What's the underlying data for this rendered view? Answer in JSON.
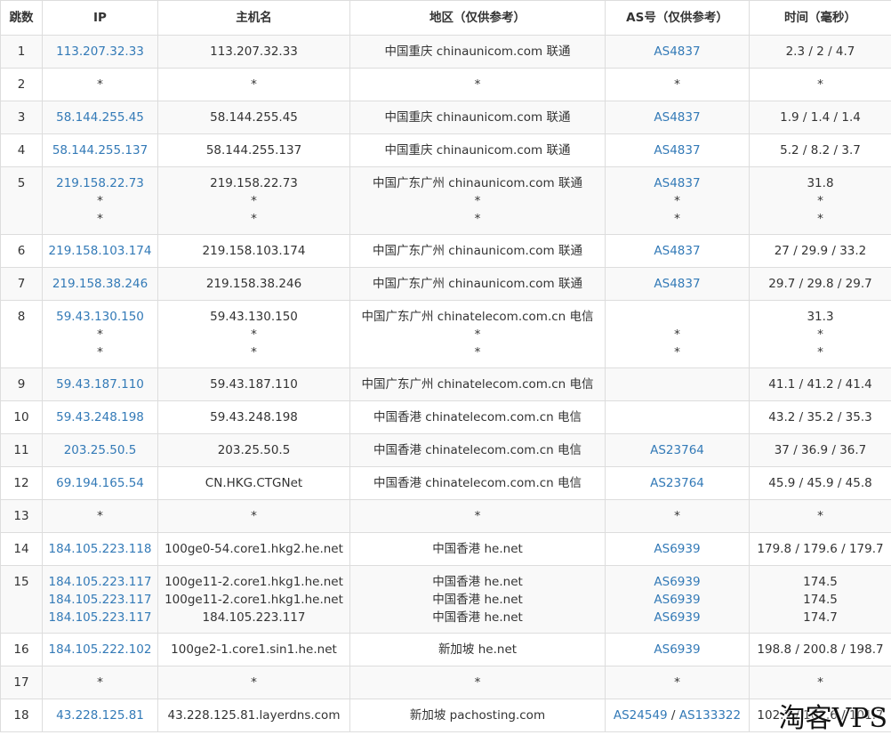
{
  "headers": [
    "跳数",
    "IP",
    "主机名",
    "地区（仅供参考）",
    "AS号（仅供参考）",
    "时间（毫秒）"
  ],
  "rows": [
    {
      "hop": "1",
      "ip": [
        "113.207.32.33"
      ],
      "host": [
        "113.207.32.33"
      ],
      "region": [
        "中国重庆 chinaunicom.com 联通"
      ],
      "as": [
        "AS4837"
      ],
      "time": [
        "2.3 / 2 / 4.7"
      ]
    },
    {
      "hop": "2",
      "ip": [
        "*"
      ],
      "host": [
        "*"
      ],
      "region": [
        "*"
      ],
      "as": [
        "*"
      ],
      "time": [
        "*"
      ]
    },
    {
      "hop": "3",
      "ip": [
        "58.144.255.45"
      ],
      "host": [
        "58.144.255.45"
      ],
      "region": [
        "中国重庆 chinaunicom.com 联通"
      ],
      "as": [
        "AS4837"
      ],
      "time": [
        "1.9 / 1.4 / 1.4"
      ]
    },
    {
      "hop": "4",
      "ip": [
        "58.144.255.137"
      ],
      "host": [
        "58.144.255.137"
      ],
      "region": [
        "中国重庆 chinaunicom.com 联通"
      ],
      "as": [
        "AS4837"
      ],
      "time": [
        "5.2 / 8.2 / 3.7"
      ]
    },
    {
      "hop": "5",
      "ip": [
        "219.158.22.73",
        "*",
        "*"
      ],
      "host": [
        "219.158.22.73",
        "*",
        "*"
      ],
      "region": [
        "中国广东广州 chinaunicom.com 联通",
        "*",
        "*"
      ],
      "as": [
        "AS4837",
        "*",
        "*"
      ],
      "time": [
        "31.8",
        "*",
        "*"
      ]
    },
    {
      "hop": "6",
      "ip": [
        "219.158.103.174"
      ],
      "host": [
        "219.158.103.174"
      ],
      "region": [
        "中国广东广州 chinaunicom.com 联通"
      ],
      "as": [
        "AS4837"
      ],
      "time": [
        "27 / 29.9 / 33.2"
      ]
    },
    {
      "hop": "7",
      "ip": [
        "219.158.38.246"
      ],
      "host": [
        "219.158.38.246"
      ],
      "region": [
        "中国广东广州 chinaunicom.com 联通"
      ],
      "as": [
        "AS4837"
      ],
      "time": [
        "29.7 / 29.8 / 29.7"
      ]
    },
    {
      "hop": "8",
      "ip": [
        "59.43.130.150",
        "*",
        "*"
      ],
      "host": [
        "59.43.130.150",
        "*",
        "*"
      ],
      "region": [
        "中国广东广州 chinatelecom.com.cn 电信",
        "*",
        "*"
      ],
      "as": [
        "",
        "*",
        "*"
      ],
      "time": [
        "31.3",
        "*",
        "*"
      ]
    },
    {
      "hop": "9",
      "ip": [
        "59.43.187.110"
      ],
      "host": [
        "59.43.187.110"
      ],
      "region": [
        "中国广东广州 chinatelecom.com.cn 电信"
      ],
      "as": [
        ""
      ],
      "time": [
        "41.1 / 41.2 / 41.4"
      ]
    },
    {
      "hop": "10",
      "ip": [
        "59.43.248.198"
      ],
      "host": [
        "59.43.248.198"
      ],
      "region": [
        "中国香港 chinatelecom.com.cn 电信"
      ],
      "as": [
        ""
      ],
      "time": [
        "43.2 / 35.2 / 35.3"
      ]
    },
    {
      "hop": "11",
      "ip": [
        "203.25.50.5"
      ],
      "host": [
        "203.25.50.5"
      ],
      "region": [
        "中国香港 chinatelecom.com.cn 电信"
      ],
      "as": [
        "AS23764"
      ],
      "time": [
        "37 / 36.9 / 36.7"
      ]
    },
    {
      "hop": "12",
      "ip": [
        "69.194.165.54"
      ],
      "host": [
        "CN.HKG.CTGNet"
      ],
      "region": [
        "中国香港 chinatelecom.com.cn 电信"
      ],
      "as": [
        "AS23764"
      ],
      "time": [
        "45.9 / 45.9 / 45.8"
      ]
    },
    {
      "hop": "13",
      "ip": [
        "*"
      ],
      "host": [
        "*"
      ],
      "region": [
        "*"
      ],
      "as": [
        "*"
      ],
      "time": [
        "*"
      ]
    },
    {
      "hop": "14",
      "ip": [
        "184.105.223.118"
      ],
      "host": [
        "100ge0-54.core1.hkg2.he.net"
      ],
      "region": [
        "中国香港 he.net"
      ],
      "as": [
        "AS6939"
      ],
      "time": [
        "179.8 / 179.6 / 179.7"
      ]
    },
    {
      "hop": "15",
      "ip": [
        "184.105.223.117",
        "184.105.223.117",
        "184.105.223.117"
      ],
      "host": [
        "100ge11-2.core1.hkg1.he.net",
        "100ge11-2.core1.hkg1.he.net",
        "184.105.223.117"
      ],
      "region": [
        "中国香港 he.net",
        "中国香港 he.net",
        "中国香港 he.net"
      ],
      "as": [
        "AS6939",
        "AS6939",
        "AS6939"
      ],
      "time": [
        "174.5",
        "174.5",
        "174.7"
      ]
    },
    {
      "hop": "16",
      "ip": [
        "184.105.222.102"
      ],
      "host": [
        "100ge2-1.core1.sin1.he.net"
      ],
      "region": [
        "新加坡 he.net"
      ],
      "as": [
        "AS6939"
      ],
      "time": [
        "198.8 / 200.8 / 198.7"
      ]
    },
    {
      "hop": "17",
      "ip": [
        "*"
      ],
      "host": [
        "*"
      ],
      "region": [
        "*"
      ],
      "as": [
        "*"
      ],
      "time": [
        "*"
      ]
    },
    {
      "hop": "18",
      "ip": [
        "43.228.125.81"
      ],
      "host": [
        "43.228.125.81.layerdns.com"
      ],
      "region": [
        "新加坡 pachosting.com"
      ],
      "as": [
        "AS24549 / AS133322"
      ],
      "time": [
        "102.7 / 102.6 / 101.7"
      ]
    }
  ],
  "watermark": "淘客VPS",
  "colors": {
    "link": "#337ab7",
    "text": "#333333",
    "border": "#dddddd",
    "row_stripe": "#f9f9f9"
  }
}
